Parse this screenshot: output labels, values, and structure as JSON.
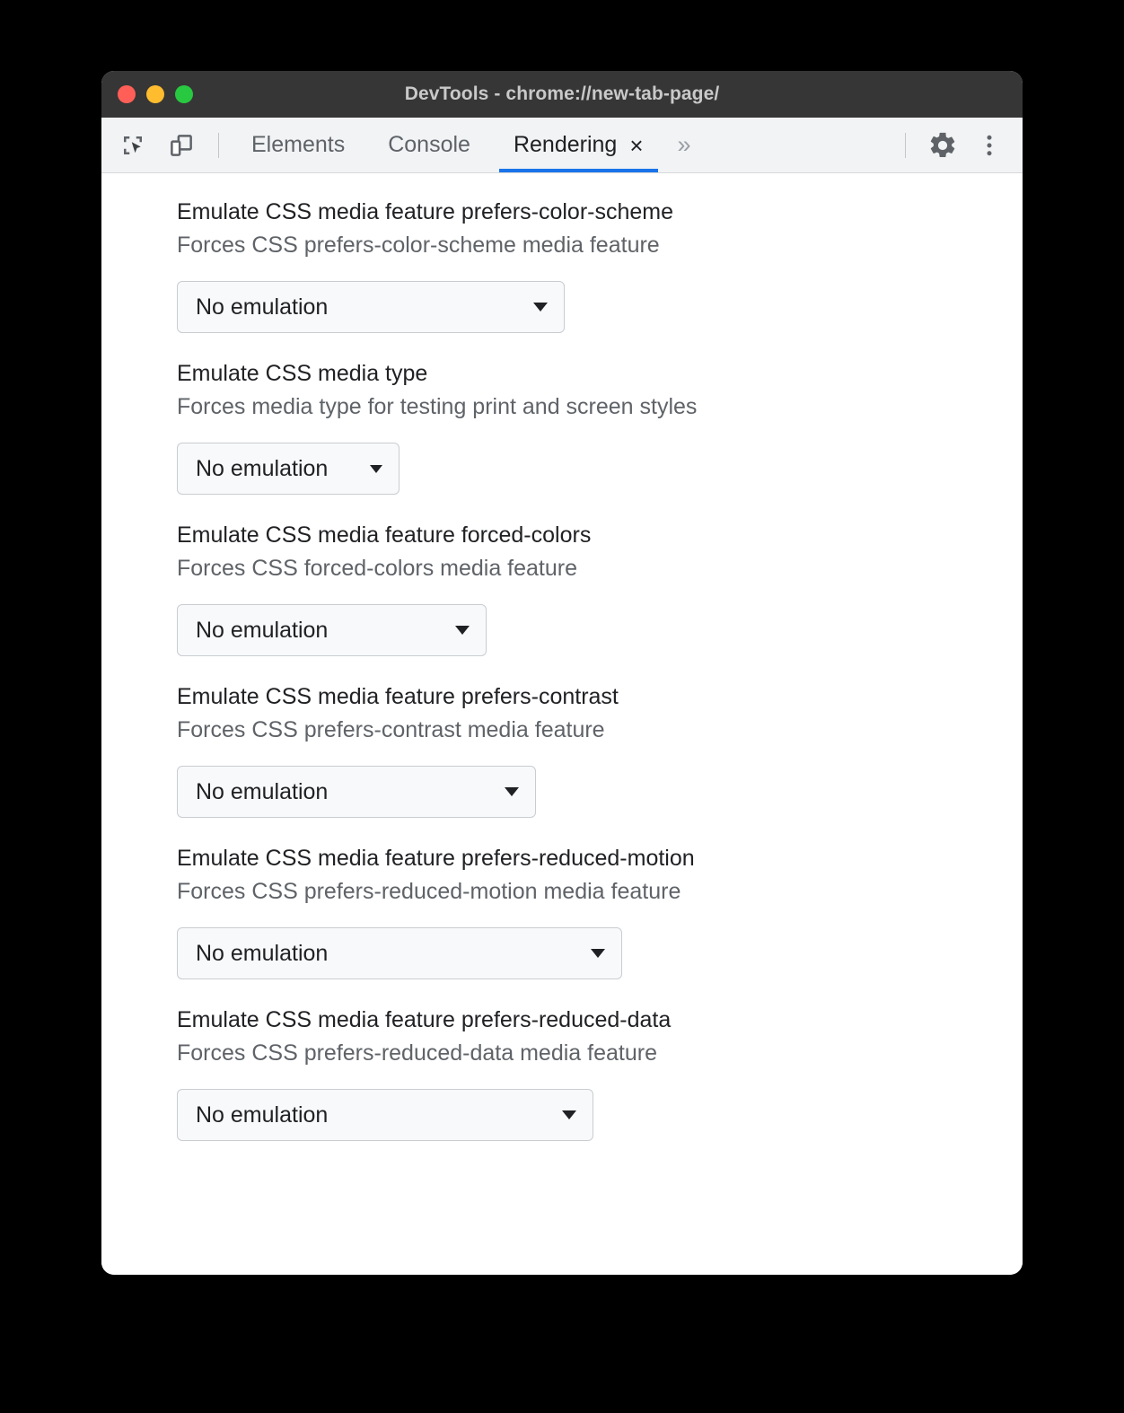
{
  "window": {
    "title": "DevTools - chrome://new-tab-page/",
    "traffic_lights": [
      {
        "name": "close",
        "color": "#ff5f57"
      },
      {
        "name": "minimize",
        "color": "#febc2e"
      },
      {
        "name": "zoom",
        "color": "#28c840"
      }
    ]
  },
  "toolbar": {
    "inspect_icon": "inspect-element-icon",
    "device_icon": "device-toolbar-icon",
    "tabs": [
      {
        "label": "Elements",
        "active": false,
        "closable": false
      },
      {
        "label": "Console",
        "active": false,
        "closable": false
      },
      {
        "label": "Rendering",
        "active": true,
        "closable": true,
        "close_glyph": "×"
      }
    ],
    "more_tabs_glyph": "»",
    "settings_icon": "gear-icon",
    "menu_icon": "more-vertical-icon",
    "accent_color": "#1a73e8"
  },
  "panel": {
    "settings": [
      {
        "title": "Emulate CSS media feature prefers-color-scheme",
        "description": "Forces CSS prefers-color-scheme media feature",
        "select_value": "No emulation",
        "select_width": 432
      },
      {
        "title": "Emulate CSS media type",
        "description": "Forces media type for testing print and screen styles",
        "select_value": "No emulation",
        "select_width": 248
      },
      {
        "title": "Emulate CSS media feature forced-colors",
        "description": "Forces CSS forced-colors media feature",
        "select_value": "No emulation",
        "select_width": 345
      },
      {
        "title": "Emulate CSS media feature prefers-contrast",
        "description": "Forces CSS prefers-contrast media feature",
        "select_value": "No emulation",
        "select_width": 400
      },
      {
        "title": "Emulate CSS media feature prefers-reduced-motion",
        "description": "Forces CSS prefers-reduced-motion media feature",
        "select_value": "No emulation",
        "select_width": 496
      },
      {
        "title": "Emulate CSS media feature prefers-reduced-data",
        "description": "Forces CSS prefers-reduced-data media feature",
        "select_value": "No emulation",
        "select_width": 464
      }
    ]
  }
}
